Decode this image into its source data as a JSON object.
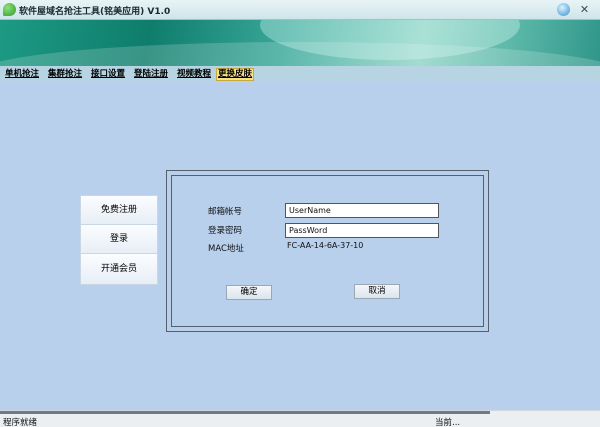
{
  "window": {
    "title": "软件屋域名抢注工具(铭美应用) V1.0"
  },
  "tabs": [
    {
      "label": "单机抢注"
    },
    {
      "label": "集群抢注"
    },
    {
      "label": "接口设置"
    },
    {
      "label": "登陆注册"
    },
    {
      "label": "视频教程"
    },
    {
      "label": "更换皮肤",
      "active": true
    }
  ],
  "sidebar": {
    "items": [
      {
        "label": "免费注册"
      },
      {
        "label": "登录"
      },
      {
        "label": "开通会员"
      }
    ]
  },
  "form": {
    "email_label": "邮箱帐号",
    "email_value": "UserName",
    "password_label": "登录密码",
    "password_value": "PassWord",
    "mac_label": "MAC地址",
    "mac_value": "FC-AA-14-6A-37-10",
    "confirm_label": "确定",
    "cancel_label": "取消"
  },
  "status": {
    "left": "程序就绪",
    "right": "当前..."
  },
  "colors": {
    "content_bg": "#b8d0ec",
    "active_tab": "#f6e08a",
    "banner": "#1d9a84"
  }
}
